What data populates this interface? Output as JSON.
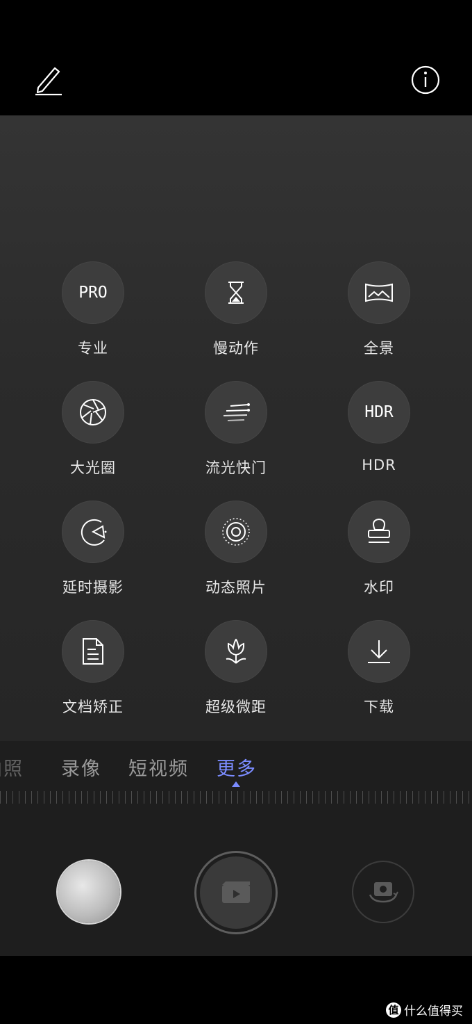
{
  "modes_grid": [
    {
      "label": "专业",
      "icon": "pro-icon",
      "icon_text": "PRO"
    },
    {
      "label": "慢动作",
      "icon": "hourglass-icon"
    },
    {
      "label": "全景",
      "icon": "panorama-icon"
    },
    {
      "label": "大光圈",
      "icon": "aperture-icon"
    },
    {
      "label": "流光快门",
      "icon": "light-trail-icon"
    },
    {
      "label": "HDR",
      "icon": "hdr-icon",
      "icon_text": "HDR"
    },
    {
      "label": "延时摄影",
      "icon": "timelapse-icon"
    },
    {
      "label": "动态照片",
      "icon": "moving-picture-icon"
    },
    {
      "label": "水印",
      "icon": "watermark-stamp-icon"
    },
    {
      "label": "文档矫正",
      "icon": "document-icon"
    },
    {
      "label": "超级微距",
      "icon": "macro-flower-icon"
    },
    {
      "label": "下载",
      "icon": "download-icon"
    }
  ],
  "mode_bar": {
    "items": [
      "拍照",
      "录像",
      "短视频",
      "更多"
    ],
    "partial_first_visible": "拍照",
    "active": "更多"
  },
  "colors": {
    "accent": "#7b8cff",
    "background": "#2b2b2b",
    "circle": "#3d3d3d"
  },
  "top_bar": {
    "left_icon": "edit-pencil-icon",
    "right_icon": "info-icon"
  },
  "watermark": {
    "text": "什么值得买",
    "logo": "值"
  }
}
